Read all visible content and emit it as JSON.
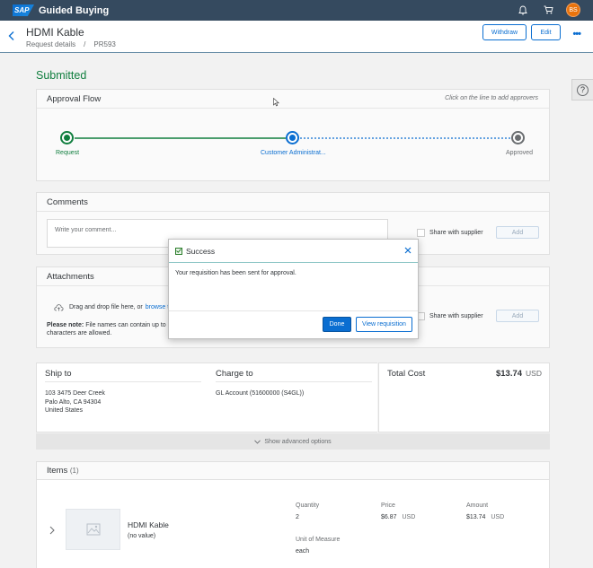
{
  "shell": {
    "logo_text": "SAP",
    "app_title": "Guided Buying",
    "avatar_initials": "BS"
  },
  "header": {
    "title": "HDMI Kable",
    "breadcrumb": [
      "Request details",
      "/",
      "PR593"
    ],
    "withdraw_label": "Withdraw",
    "edit_label": "Edit",
    "more_label": "•••"
  },
  "status": {
    "title": "Submitted",
    "help_label": "?"
  },
  "approval_flow": {
    "title": "Approval Flow",
    "hint": "Click on the line to add approvers",
    "steps": [
      {
        "label": "Request",
        "state": "done"
      },
      {
        "label": "Customer Administrat...",
        "state": "current"
      },
      {
        "label": "Approved",
        "state": "pending"
      }
    ],
    "colors": {
      "done": "#107e3e",
      "current": "#0a6ed1",
      "pending": "#6a6d70"
    }
  },
  "comments": {
    "title": "Comments",
    "placeholder": "Write your comment...",
    "share_label": "Share with supplier",
    "add_label": "Add"
  },
  "attachments": {
    "title": "Attachments",
    "drop_text": "Drag and drop file here, or",
    "browse_text": "browse t",
    "note_bold": "Please note:",
    "note_text": " File names can contain up to",
    "note_text2": "characters are allowed.",
    "share_label": "Share with supplier",
    "add_label": "Add"
  },
  "ship_to": {
    "title": "Ship to",
    "lines": [
      "103 3475 Deer Creek",
      "Palo Alto, CA  94304",
      "United States"
    ]
  },
  "charge_to": {
    "title": "Charge to",
    "account": "GL Account (51600000 (S4GL))"
  },
  "total": {
    "title": "Total Cost",
    "amount": "$13.74",
    "currency": "USD"
  },
  "advanced": {
    "label": "Show advanced options"
  },
  "items": {
    "title": "Items",
    "count": "(1)",
    "list": [
      {
        "name": "HDMI Kable",
        "subtitle": "(no value)",
        "quantity_label": "Quantity",
        "quantity": "2",
        "price_label": "Price",
        "price": "$6.87",
        "price_currency": "USD",
        "amount_label": "Amount",
        "amount": "$13.74",
        "amount_currency": "USD",
        "uom_label": "Unit of Measure",
        "uom": "each"
      }
    ]
  },
  "dialog": {
    "title": "Success",
    "message": "Your requisition has been sent for approval.",
    "done_label": "Done",
    "view_label": "View requisition"
  }
}
